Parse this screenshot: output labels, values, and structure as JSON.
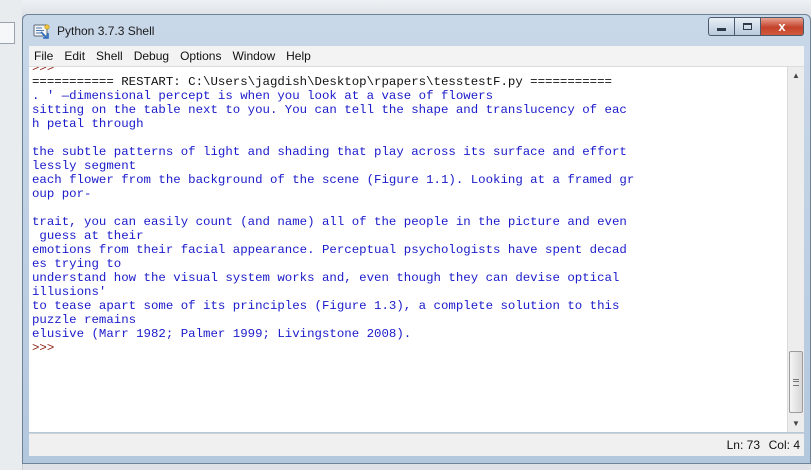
{
  "window": {
    "title": "Python 3.7.3 Shell",
    "controls": {
      "close": "x"
    }
  },
  "menu": [
    "File",
    "Edit",
    "Shell",
    "Debug",
    "Options",
    "Window",
    "Help"
  ],
  "shell": {
    "top_prompt": ">>>",
    "restart_line": "=========== RESTART: C:\\Users\\jagdish\\Desktop\\rpapers\\tesstestF.py ===========",
    "lines": [
      ". ' —dimensional percept is when you look at a vase of flowers",
      "sitting on the table next to you. You can tell the shape and translucency of eac",
      "h petal through",
      "",
      "the subtle patterns of light and shading that play across its surface and effort",
      "lessly segment",
      "each flower from the background of the scene (Figure 1.1). Looking at a framed gr",
      "oup por-",
      "",
      "trait, you can easily count (and name) all of the people in the picture and even",
      " guess at their",
      "emotions from their facial appearance. Perceptual psychologists have spent decad",
      "es trying to",
      "understand how the visual system works and, even though they can devise optical",
      "illusions'",
      "to tease apart some of its principles (Figure 1.3), a complete solution to this",
      "puzzle remains",
      "elusive (Marr 1982; Palmer 1999; Livingstone 2008)."
    ],
    "bottom_prompt": ">>>"
  },
  "status": {
    "ln": "Ln: 73",
    "col": "Col: 4"
  },
  "colors": {
    "output_text": "#1a1acb",
    "prompt": "#8b1e12",
    "close_button": "#c4422b"
  }
}
